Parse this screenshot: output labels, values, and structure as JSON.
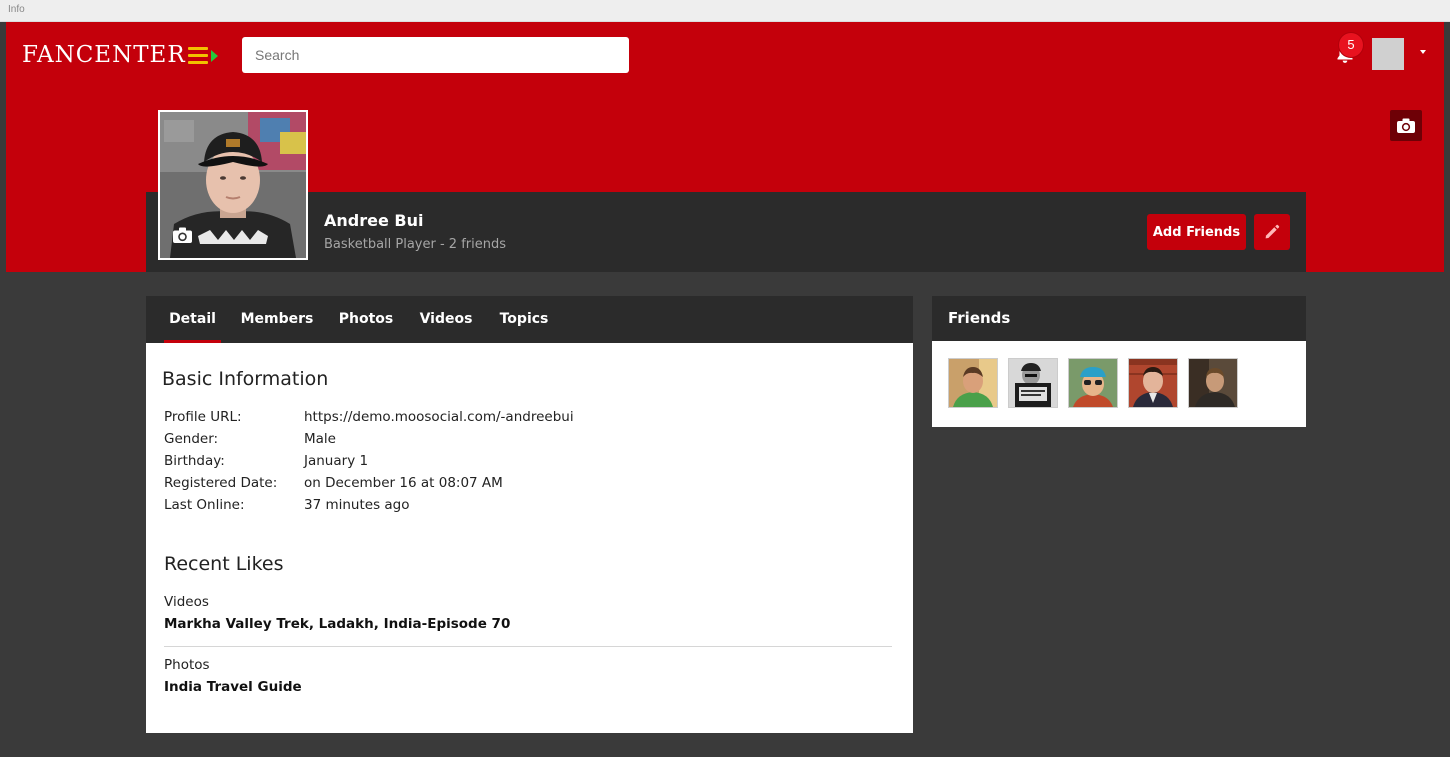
{
  "browser": {
    "title": "Info"
  },
  "header": {
    "logo": "FANCENTER",
    "search_placeholder": "Search",
    "notifications_count": "5"
  },
  "profile": {
    "name": "Andree Bui",
    "subtitle": "Basketball Player - 2 friends",
    "add_friends_label": "Add Friends"
  },
  "tabs": [
    {
      "label": "Detail",
      "active": true
    },
    {
      "label": "Members"
    },
    {
      "label": "Photos"
    },
    {
      "label": "Videos"
    },
    {
      "label": "Topics"
    }
  ],
  "basic_info": {
    "title": "Basic Information",
    "rows": [
      {
        "label": "Profile URL:",
        "value": "https://demo.moosocial.com/-andreebui"
      },
      {
        "label": "Gender:",
        "value": "Male"
      },
      {
        "label": "Birthday:",
        "value": "January 1"
      },
      {
        "label": "Registered Date:",
        "value": "on December 16 at 08:07 AM"
      },
      {
        "label": "Last Online:",
        "value": "37 minutes ago"
      }
    ]
  },
  "recent_likes": {
    "title": "Recent Likes",
    "groups": [
      {
        "category": "Videos",
        "item": "Markha Valley Trek, Ladakh, India-Episode 70"
      },
      {
        "category": "Photos",
        "item": "India Travel Guide"
      }
    ]
  },
  "friends": {
    "title": "Friends",
    "items": [
      "friend-1",
      "friend-2",
      "friend-3",
      "friend-4",
      "friend-5"
    ]
  },
  "colors": {
    "brand_red": "#c4000b",
    "dark_bar": "#2b2b2b",
    "page_bg": "#3a3a3a",
    "logo_menu_yellow": "#f2c200",
    "logo_menu_green": "#23c93c"
  },
  "icons": {
    "menu": "hamburger-arrow-icon",
    "notifications": "bell-icon",
    "cover_photo": "camera-icon",
    "avatar_photo": "camera-icon",
    "edit": "pencil-icon",
    "user_menu": "caret-down-icon"
  }
}
